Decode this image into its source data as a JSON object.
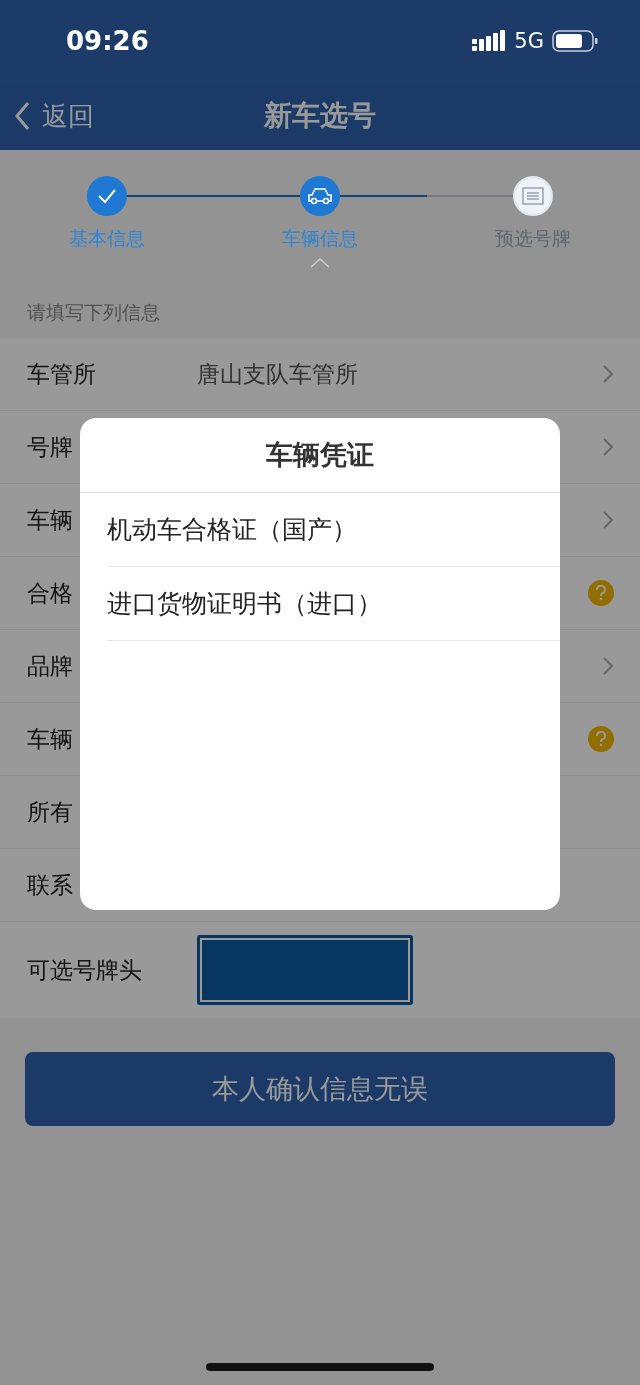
{
  "status_bar": {
    "time": "09:26",
    "network": "5G"
  },
  "nav": {
    "back": "返回",
    "title": "新车选号"
  },
  "steps": [
    {
      "label": "基本信息",
      "kind": "done"
    },
    {
      "label": "车辆信息",
      "kind": "current"
    },
    {
      "label": "预选号牌",
      "kind": "pending"
    }
  ],
  "section_label": "请填写下列信息",
  "rows": [
    {
      "label": "车管所",
      "value": "唐山支队车管所",
      "kind": "chevron"
    },
    {
      "label": "号牌",
      "kind": "chevron"
    },
    {
      "label": "车辆",
      "kind": "chevron"
    },
    {
      "label": "合格",
      "kind": "help"
    },
    {
      "label": "品牌",
      "kind": "chevron"
    },
    {
      "label": "车辆",
      "kind": "help"
    },
    {
      "label": "所有",
      "kind": "plain"
    },
    {
      "label": "联系",
      "kind": "plain"
    },
    {
      "label": "可选号牌头",
      "kind": "plate"
    }
  ],
  "confirm_button": "本人确认信息无误",
  "dialog": {
    "title": "车辆凭证",
    "options": [
      "机动车合格证（国产）",
      "进口货物证明书（进口）"
    ]
  }
}
